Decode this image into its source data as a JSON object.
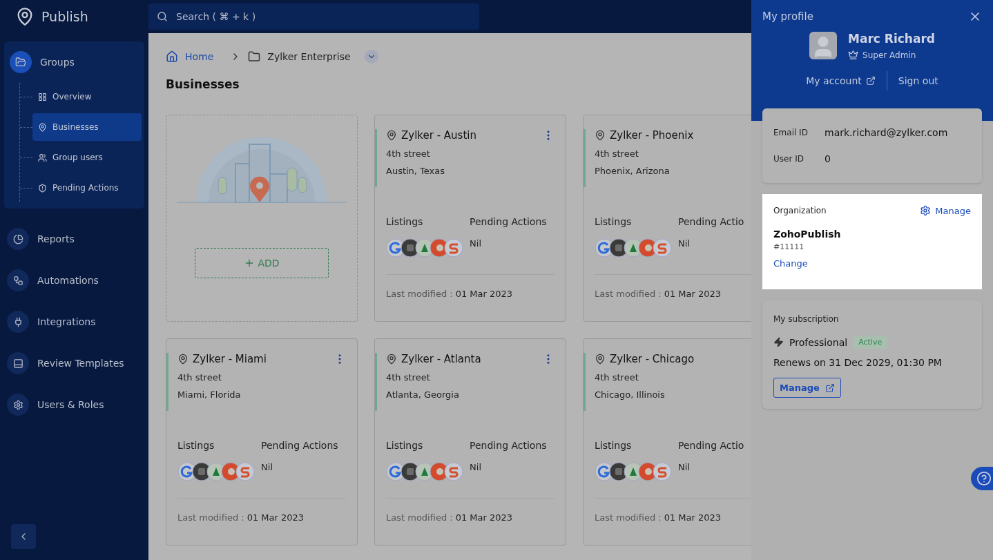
{
  "app": {
    "name": "Publish"
  },
  "search": {
    "placeholder": "Search ( ⌘ + k )"
  },
  "sidebar": {
    "group": {
      "label": "Groups",
      "children": [
        {
          "label": "Overview",
          "selected": false
        },
        {
          "label": "Businesses",
          "selected": true
        },
        {
          "label": "Group users",
          "selected": false
        },
        {
          "label": "Pending Actions",
          "selected": false
        }
      ]
    },
    "items": [
      {
        "label": "Reports"
      },
      {
        "label": "Automations"
      },
      {
        "label": "Integrations"
      },
      {
        "label": "Review Templates"
      },
      {
        "label": "Users & Roles"
      }
    ]
  },
  "breadcrumb": {
    "home": "Home",
    "current": "Zylker Enterprise"
  },
  "page_title": "Businesses",
  "add_card": {
    "button": "ADD"
  },
  "businesses": [
    {
      "name": "Zylker - Austin",
      "street": "4th street",
      "city": "Austin, Texas",
      "listings_label": "Listings",
      "pending_label": "Pending Actions",
      "pending": "Nil",
      "modified_label": "Last modified :",
      "modified_date": "01 Mar 2023"
    },
    {
      "name": "Zylker - Phoenix",
      "street": "4th street",
      "city": "Phoenix, Arizona",
      "listings_label": "Listings",
      "pending_label": "Pending Actio",
      "pending": "Nil",
      "modified_label": "Last modified :",
      "modified_date": "01 Mar 2023"
    },
    {
      "name": "Zylker - Miami",
      "street": "4th street",
      "city": "Miami, Florida",
      "listings_label": "Listings",
      "pending_label": "Pending Actions",
      "pending": "Nil",
      "modified_label": "Last modified :",
      "modified_date": "01 Mar 2023"
    },
    {
      "name": "Zylker - Atlanta",
      "street": "4th street",
      "city": "Atlanta, Georgia",
      "listings_label": "Listings",
      "pending_label": "Pending Actions",
      "pending": "Nil",
      "modified_label": "Last modified :",
      "modified_date": "01 Mar 2023"
    },
    {
      "name": "Zylker - Chicago",
      "street": "4th street",
      "city": "Chicago, Illinois",
      "listings_label": "Listings",
      "pending_label": "Pending Actio",
      "pending": "Nil",
      "modified_label": "Last modified :",
      "modified_date": "01 Mar 2023"
    }
  ],
  "profile": {
    "title": "My profile",
    "name": "Marc Richard",
    "role": "Super Admin",
    "account_link": "My account",
    "sign_out": "Sign out",
    "details": [
      {
        "label": "Email ID",
        "value": "mark.richard@zylker.com"
      },
      {
        "label": "User ID",
        "value": "0"
      }
    ],
    "organization": {
      "heading": "Organization",
      "manage": "Manage",
      "name": "ZohoPublish",
      "id": "#11111",
      "change": "Change"
    },
    "subscription": {
      "heading": "My subscription",
      "plan": "Professional",
      "status": "Active",
      "renews": "Renews on 31 Dec 2029, 01:30 PM",
      "manage": "Manage"
    }
  }
}
